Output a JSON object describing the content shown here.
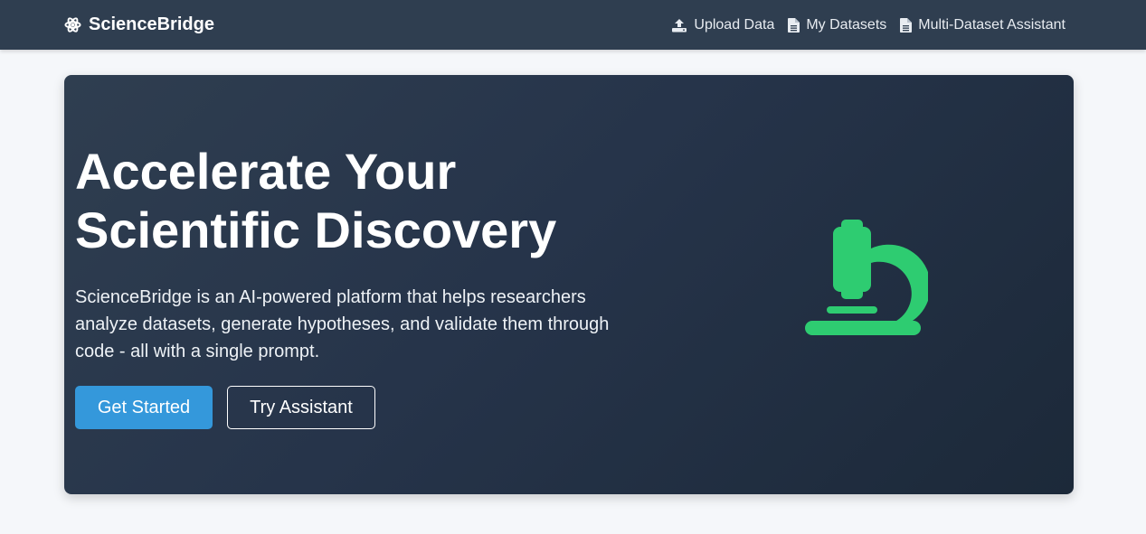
{
  "navbar": {
    "brand": "ScienceBridge",
    "brand_icon": "atom-icon",
    "links": [
      {
        "label": "Upload Data",
        "icon": "upload-icon"
      },
      {
        "label": "My Datasets",
        "icon": "file-icon"
      },
      {
        "label": "Multi-Dataset Assistant",
        "icon": "file-icon"
      }
    ]
  },
  "hero": {
    "title_line1": "Accelerate Your",
    "title_line2": "Scientific Discovery",
    "description_line1": "ScienceBridge is an AI-powered platform that helps researchers",
    "description_line2": "analyze datasets, generate hypotheses, and validate them through",
    "description_line3": "code - all with a single prompt.",
    "primary_button": "Get Started",
    "secondary_button": "Try Assistant",
    "illustration_icon": "microscope-icon"
  },
  "colors": {
    "navbar_bg": "#2f3e50",
    "primary": "#3498db",
    "accent_green": "#2ecc71",
    "page_bg": "#f5f7fa"
  }
}
